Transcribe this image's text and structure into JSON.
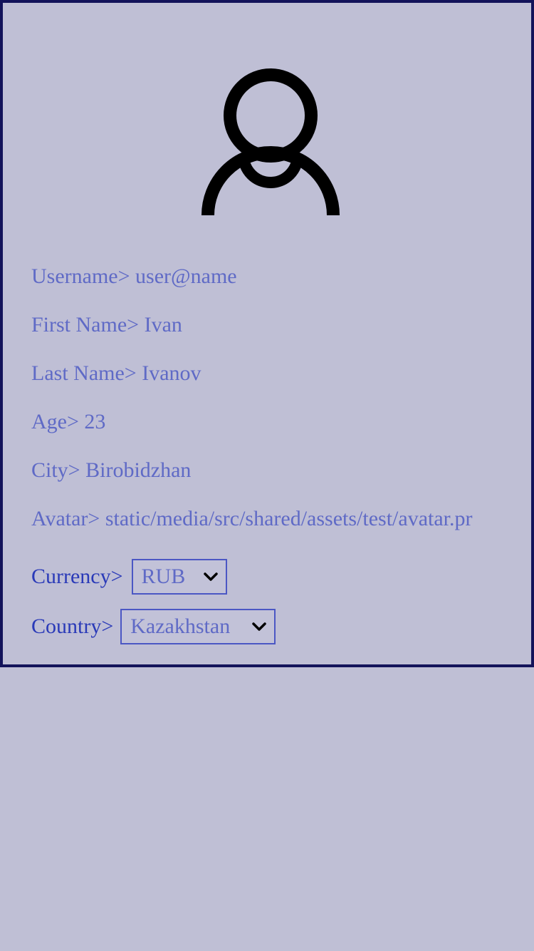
{
  "profile": {
    "username": {
      "label": "Username>",
      "value": "user@name"
    },
    "first_name": {
      "label": "First Name>",
      "value": "Ivan"
    },
    "last_name": {
      "label": "Last Name>",
      "value": "Ivanov"
    },
    "age": {
      "label": "Age>",
      "value": "23"
    },
    "city": {
      "label": "City>",
      "value": "Birobidzhan"
    },
    "avatar": {
      "label": "Avatar>",
      "value": "static/media/src/shared/assets/test/avatar.pr"
    },
    "currency": {
      "label": "Currency>",
      "selected": "RUB"
    },
    "country": {
      "label": "Country>",
      "selected": "Kazakhstan"
    }
  },
  "icons": {
    "avatar": "user-avatar-icon",
    "select_arrow": "chevron-down-icon"
  },
  "colors": {
    "background": "#bfbfd5",
    "border": "#13135a",
    "text": "#5f6ac6",
    "select_label": "#2a3ab8"
  }
}
